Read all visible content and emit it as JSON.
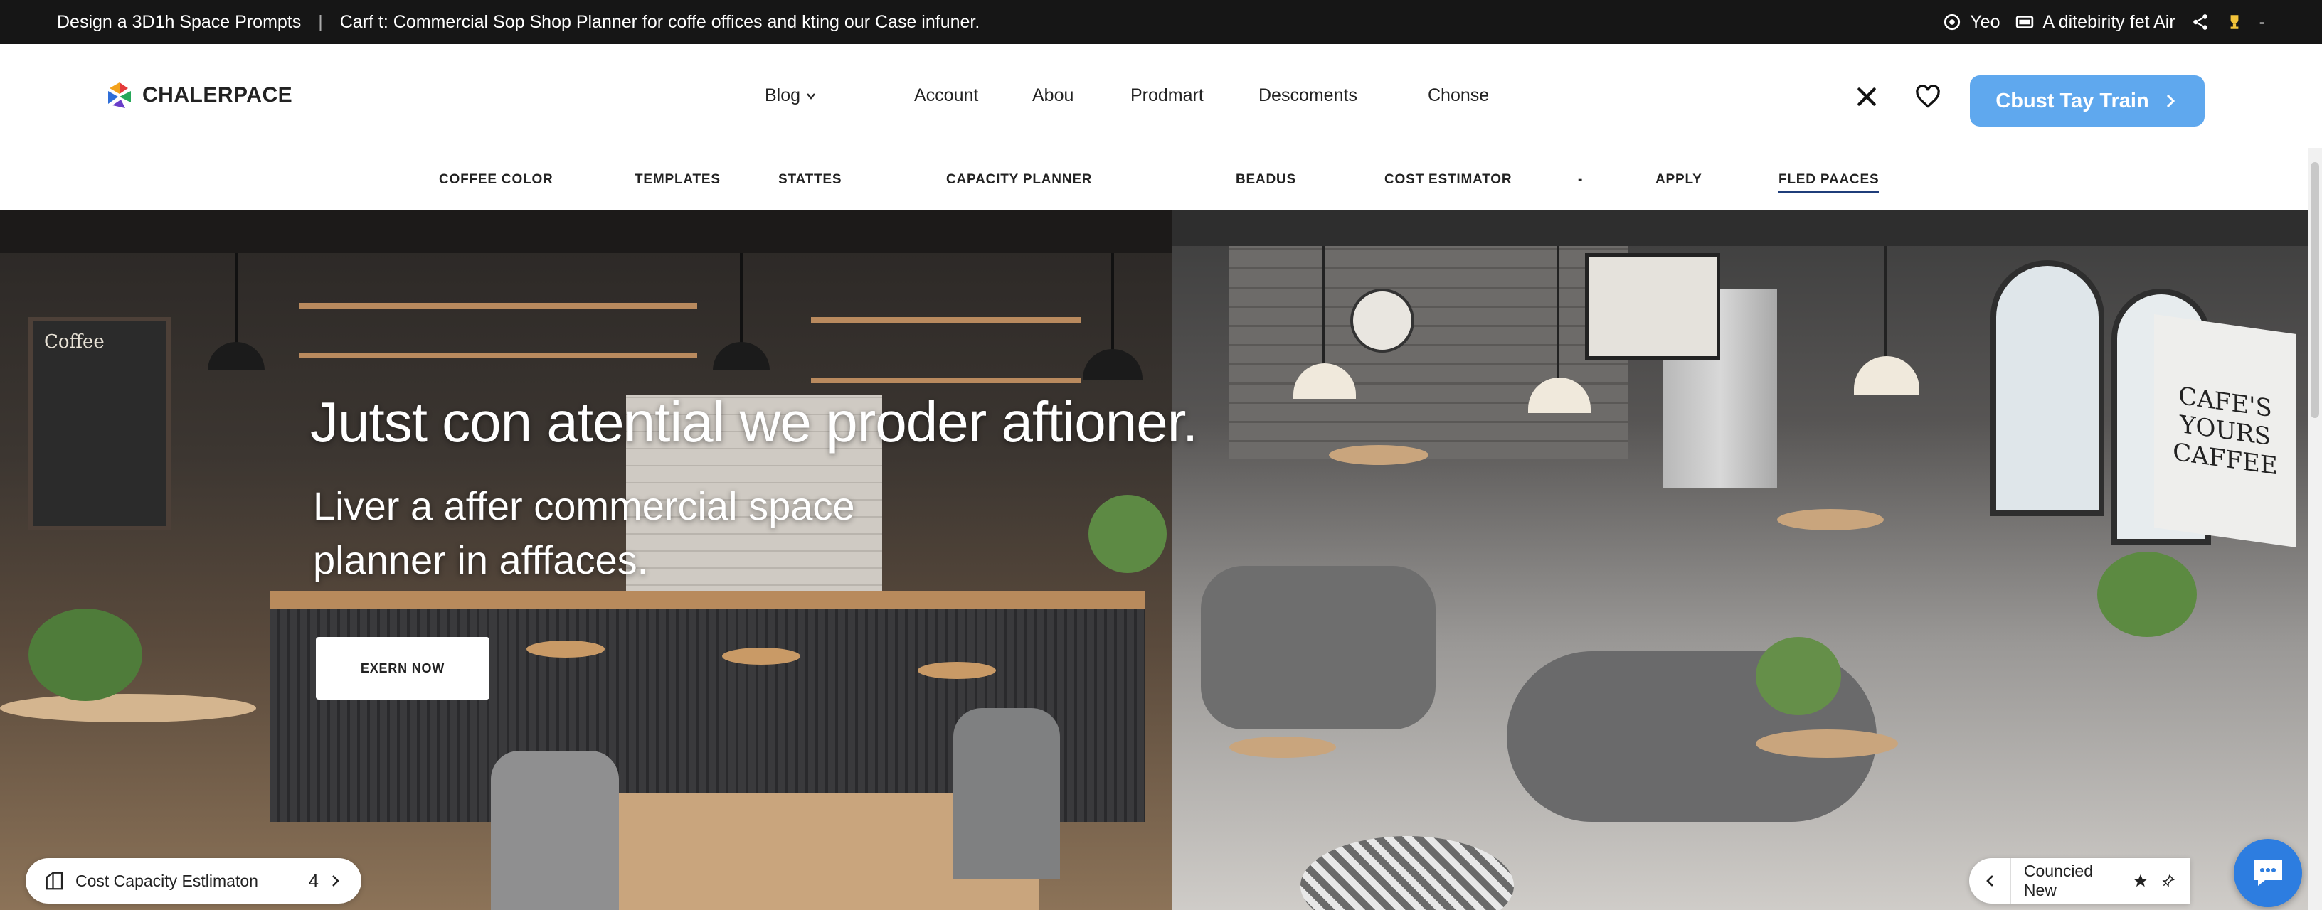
{
  "topbar": {
    "left_text": "Design a 3D1h Space Prompts",
    "separator": "|",
    "announcement": "Carf t: Commercial Sop Shop Planner for coffe offices and kting our Case infuner.",
    "right_items": [
      "Yeo",
      "A ditebirity fet Air"
    ],
    "dash": "-"
  },
  "header": {
    "logo_text": "CHALERPACE",
    "nav": [
      {
        "label": "Blog",
        "dropdown": true
      },
      {
        "label": "Account"
      },
      {
        "label": "Abou"
      },
      {
        "label": "Prodmart"
      },
      {
        "label": "Descoments"
      },
      {
        "label": "Chonse"
      }
    ],
    "cta_label": "Cbust Tay Train"
  },
  "subnav": {
    "items": [
      "COFFEE COLOR",
      "TEMPLATES",
      "STATTES",
      "CAPACITY PLANNER",
      "BEADUS",
      "COST ESTIMATOR",
      "-",
      "APPLY",
      "FLED PAACES"
    ],
    "active": "FLED PAACES"
  },
  "hero": {
    "title": "Jutst  con atential we proder aftioner.",
    "subtitle": "Liver a affer commercial space planner in afffaces.",
    "button_label": "EXERN NOW",
    "left_scene_sign": "Coffee",
    "right_scene_sign": "CAFE'S YOURS CAFFEE"
  },
  "bottom_left_pill": {
    "label": "Cost Capacity Estlimaton",
    "count": "4"
  },
  "bottom_right_pill": {
    "label": "Councied New"
  },
  "colors": {
    "topbar_bg": "#161616",
    "cta_bg": "#5fa8ee",
    "active_underline": "#1f3d7a",
    "chat_bg": "#2d7de0"
  },
  "icons": [
    "eye-icon",
    "card-icon",
    "share-icon",
    "trophy-icon",
    "close-icon",
    "heart-icon",
    "arrow-right-icon",
    "store-icon",
    "chevron-right-icon",
    "chevron-left-icon",
    "star-icon",
    "pin-icon",
    "chat-icon"
  ]
}
